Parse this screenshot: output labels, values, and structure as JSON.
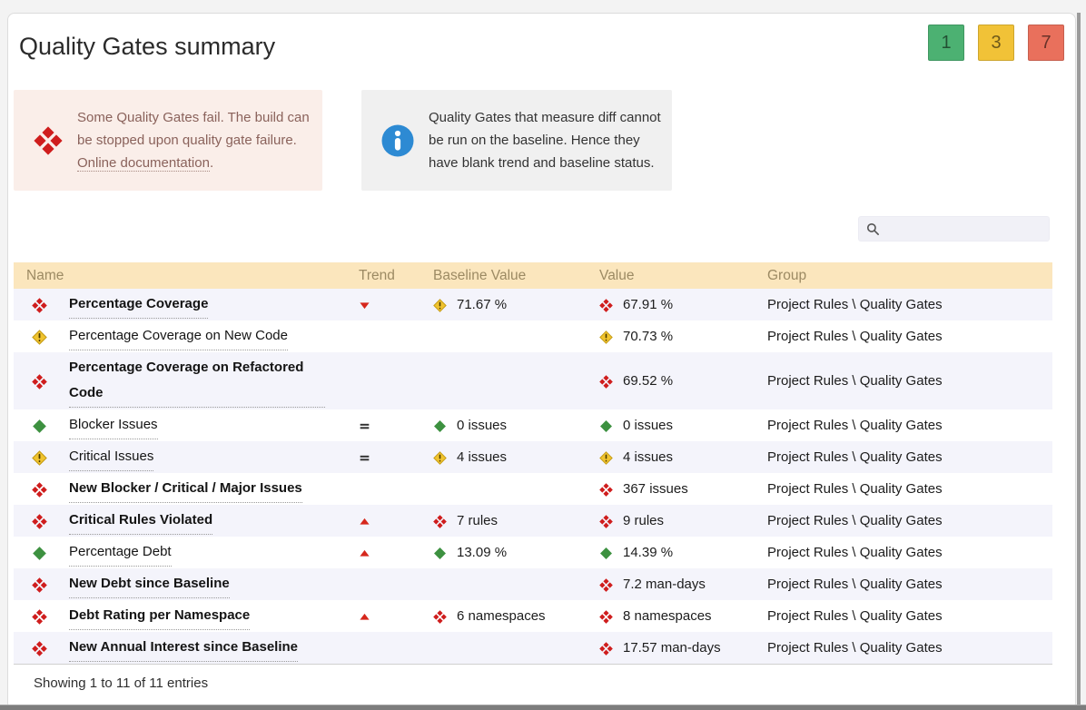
{
  "colors": {
    "pass": "#3d9140",
    "warn": "#f0c32e",
    "fail": "#cf1d1d",
    "trend_arrow": "#d6271c",
    "equal": "#2f2f2f",
    "info_icon": "#2d8ad3",
    "badge_pass_bg": "#4cb172",
    "badge_warn_bg": "#f1c237",
    "badge_fail_bg": "#e9705c",
    "table_header_bg": "#fbe6bd"
  },
  "page": {
    "title": "Quality Gates summary",
    "badges": [
      {
        "label": "1",
        "level": "pass"
      },
      {
        "label": "3",
        "level": "warn"
      },
      {
        "label": "7",
        "level": "fail"
      }
    ],
    "warning_box": {
      "icon": "fail-diamond-icon",
      "text": "Some Quality Gates fail. The build can be stopped upon quality gate failure. ",
      "link_label": "Online documentation",
      "suffix": "."
    },
    "info_box": {
      "icon": "info-circle-icon",
      "text": "Quality Gates that measure diff cannot be run on the baseline. Hence they have blank trend and baseline status."
    },
    "search": {
      "value": ""
    },
    "footer": "Showing 1 to 11 of 11 entries"
  },
  "table": {
    "columns": [
      "Name",
      "Trend",
      "Baseline Value",
      "Value",
      "Group"
    ],
    "rows": [
      {
        "status": "fail",
        "name": "Percentage Coverage",
        "trend": "down",
        "baseline_status": "warn",
        "baseline": "71.67 %",
        "value_status": "fail",
        "value": "67.91 %",
        "group": "Project Rules \\ Quality Gates"
      },
      {
        "status": "warn",
        "name": "Percentage Coverage on New Code",
        "trend": "",
        "baseline_status": "",
        "baseline": "",
        "value_status": "warn",
        "value": "70.73 %",
        "group": "Project Rules \\ Quality Gates"
      },
      {
        "status": "fail",
        "name": "Percentage Coverage on Refactored Code",
        "trend": "",
        "baseline_status": "",
        "baseline": "",
        "value_status": "fail",
        "value": "69.52 %",
        "group": "Project Rules \\ Quality Gates"
      },
      {
        "status": "pass",
        "name": "Blocker Issues",
        "trend": "equal",
        "baseline_status": "pass",
        "baseline": "0 issues",
        "value_status": "pass",
        "value": "0 issues",
        "group": "Project Rules \\ Quality Gates"
      },
      {
        "status": "warn",
        "name": "Critical Issues",
        "trend": "equal",
        "baseline_status": "warn",
        "baseline": "4 issues",
        "value_status": "warn",
        "value": "4 issues",
        "group": "Project Rules \\ Quality Gates"
      },
      {
        "status": "fail",
        "name": "New Blocker / Critical / Major Issues",
        "trend": "",
        "baseline_status": "",
        "baseline": "",
        "value_status": "fail",
        "value": "367 issues",
        "group": "Project Rules \\ Quality Gates"
      },
      {
        "status": "fail",
        "name": "Critical Rules Violated",
        "trend": "up",
        "baseline_status": "fail",
        "baseline": "7 rules",
        "value_status": "fail",
        "value": "9 rules",
        "group": "Project Rules \\ Quality Gates"
      },
      {
        "status": "pass",
        "name": "Percentage Debt",
        "trend": "up",
        "baseline_status": "pass",
        "baseline": "13.09 %",
        "value_status": "pass",
        "value": "14.39 %",
        "group": "Project Rules \\ Quality Gates"
      },
      {
        "status": "fail",
        "name": "New Debt since Baseline",
        "trend": "",
        "baseline_status": "",
        "baseline": "",
        "value_status": "fail",
        "value": "7.2 man-days",
        "group": "Project Rules \\ Quality Gates"
      },
      {
        "status": "fail",
        "name": "Debt Rating per Namespace",
        "trend": "up",
        "baseline_status": "fail",
        "baseline": "6 namespaces",
        "value_status": "fail",
        "value": "8 namespaces",
        "group": "Project Rules \\ Quality Gates"
      },
      {
        "status": "fail",
        "name": "New Annual Interest since Baseline",
        "trend": "",
        "baseline_status": "",
        "baseline": "",
        "value_status": "fail",
        "value": "17.57 man-days",
        "group": "Project Rules \\ Quality Gates"
      }
    ]
  }
}
